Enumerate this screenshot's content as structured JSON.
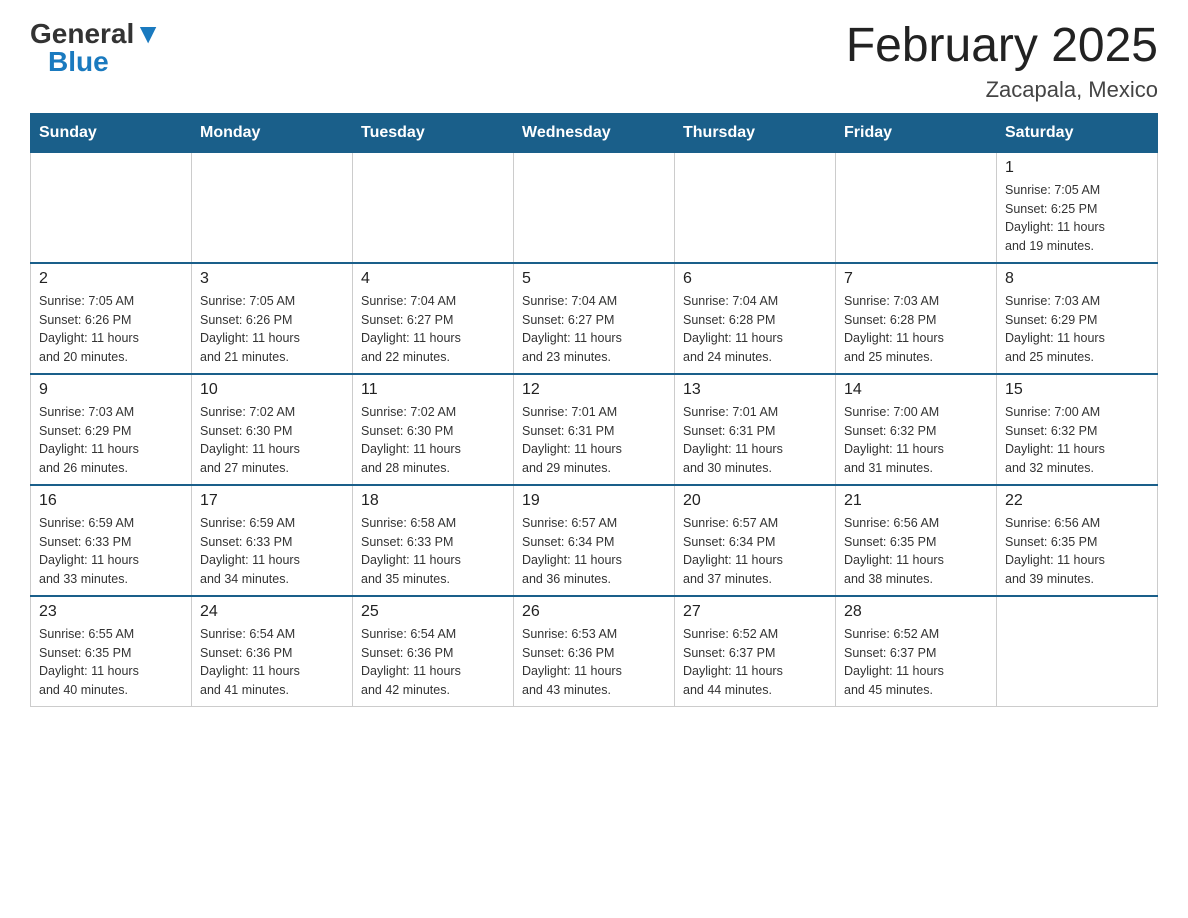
{
  "logo": {
    "general": "General",
    "blue": "Blue"
  },
  "header": {
    "title": "February 2025",
    "location": "Zacapala, Mexico"
  },
  "weekdays": [
    "Sunday",
    "Monday",
    "Tuesday",
    "Wednesday",
    "Thursday",
    "Friday",
    "Saturday"
  ],
  "weeks": [
    [
      {
        "day": "",
        "info": ""
      },
      {
        "day": "",
        "info": ""
      },
      {
        "day": "",
        "info": ""
      },
      {
        "day": "",
        "info": ""
      },
      {
        "day": "",
        "info": ""
      },
      {
        "day": "",
        "info": ""
      },
      {
        "day": "1",
        "info": "Sunrise: 7:05 AM\nSunset: 6:25 PM\nDaylight: 11 hours\nand 19 minutes."
      }
    ],
    [
      {
        "day": "2",
        "info": "Sunrise: 7:05 AM\nSunset: 6:26 PM\nDaylight: 11 hours\nand 20 minutes."
      },
      {
        "day": "3",
        "info": "Sunrise: 7:05 AM\nSunset: 6:26 PM\nDaylight: 11 hours\nand 21 minutes."
      },
      {
        "day": "4",
        "info": "Sunrise: 7:04 AM\nSunset: 6:27 PM\nDaylight: 11 hours\nand 22 minutes."
      },
      {
        "day": "5",
        "info": "Sunrise: 7:04 AM\nSunset: 6:27 PM\nDaylight: 11 hours\nand 23 minutes."
      },
      {
        "day": "6",
        "info": "Sunrise: 7:04 AM\nSunset: 6:28 PM\nDaylight: 11 hours\nand 24 minutes."
      },
      {
        "day": "7",
        "info": "Sunrise: 7:03 AM\nSunset: 6:28 PM\nDaylight: 11 hours\nand 25 minutes."
      },
      {
        "day": "8",
        "info": "Sunrise: 7:03 AM\nSunset: 6:29 PM\nDaylight: 11 hours\nand 25 minutes."
      }
    ],
    [
      {
        "day": "9",
        "info": "Sunrise: 7:03 AM\nSunset: 6:29 PM\nDaylight: 11 hours\nand 26 minutes."
      },
      {
        "day": "10",
        "info": "Sunrise: 7:02 AM\nSunset: 6:30 PM\nDaylight: 11 hours\nand 27 minutes."
      },
      {
        "day": "11",
        "info": "Sunrise: 7:02 AM\nSunset: 6:30 PM\nDaylight: 11 hours\nand 28 minutes."
      },
      {
        "day": "12",
        "info": "Sunrise: 7:01 AM\nSunset: 6:31 PM\nDaylight: 11 hours\nand 29 minutes."
      },
      {
        "day": "13",
        "info": "Sunrise: 7:01 AM\nSunset: 6:31 PM\nDaylight: 11 hours\nand 30 minutes."
      },
      {
        "day": "14",
        "info": "Sunrise: 7:00 AM\nSunset: 6:32 PM\nDaylight: 11 hours\nand 31 minutes."
      },
      {
        "day": "15",
        "info": "Sunrise: 7:00 AM\nSunset: 6:32 PM\nDaylight: 11 hours\nand 32 minutes."
      }
    ],
    [
      {
        "day": "16",
        "info": "Sunrise: 6:59 AM\nSunset: 6:33 PM\nDaylight: 11 hours\nand 33 minutes."
      },
      {
        "day": "17",
        "info": "Sunrise: 6:59 AM\nSunset: 6:33 PM\nDaylight: 11 hours\nand 34 minutes."
      },
      {
        "day": "18",
        "info": "Sunrise: 6:58 AM\nSunset: 6:33 PM\nDaylight: 11 hours\nand 35 minutes."
      },
      {
        "day": "19",
        "info": "Sunrise: 6:57 AM\nSunset: 6:34 PM\nDaylight: 11 hours\nand 36 minutes."
      },
      {
        "day": "20",
        "info": "Sunrise: 6:57 AM\nSunset: 6:34 PM\nDaylight: 11 hours\nand 37 minutes."
      },
      {
        "day": "21",
        "info": "Sunrise: 6:56 AM\nSunset: 6:35 PM\nDaylight: 11 hours\nand 38 minutes."
      },
      {
        "day": "22",
        "info": "Sunrise: 6:56 AM\nSunset: 6:35 PM\nDaylight: 11 hours\nand 39 minutes."
      }
    ],
    [
      {
        "day": "23",
        "info": "Sunrise: 6:55 AM\nSunset: 6:35 PM\nDaylight: 11 hours\nand 40 minutes."
      },
      {
        "day": "24",
        "info": "Sunrise: 6:54 AM\nSunset: 6:36 PM\nDaylight: 11 hours\nand 41 minutes."
      },
      {
        "day": "25",
        "info": "Sunrise: 6:54 AM\nSunset: 6:36 PM\nDaylight: 11 hours\nand 42 minutes."
      },
      {
        "day": "26",
        "info": "Sunrise: 6:53 AM\nSunset: 6:36 PM\nDaylight: 11 hours\nand 43 minutes."
      },
      {
        "day": "27",
        "info": "Sunrise: 6:52 AM\nSunset: 6:37 PM\nDaylight: 11 hours\nand 44 minutes."
      },
      {
        "day": "28",
        "info": "Sunrise: 6:52 AM\nSunset: 6:37 PM\nDaylight: 11 hours\nand 45 minutes."
      },
      {
        "day": "",
        "info": ""
      }
    ]
  ]
}
